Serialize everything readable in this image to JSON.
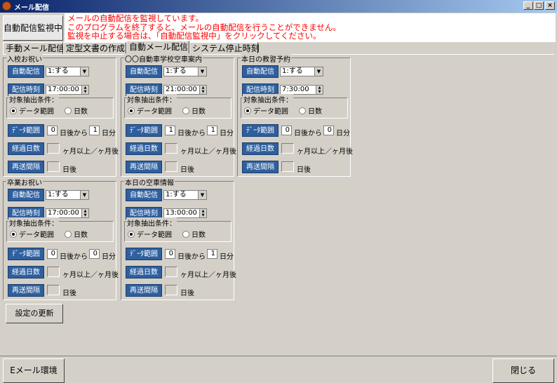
{
  "window": {
    "title": "メール配信"
  },
  "monitor_button": "自動配信監視中",
  "messages": [
    "メールの自動配信を監視しています。",
    "このプログラムを終了すると、メールの自動配信を行うことができません。",
    "監視を中止する場合は、「自動配信監視中」をクリックしてください。"
  ],
  "tabs": [
    "手動メール配信",
    "定型文書の作成",
    "自動メール配信",
    "システム停止時刻"
  ],
  "active_tab": "自動メール配信",
  "common": {
    "auto_btn": "自動配信",
    "time_btn": "配信時刻",
    "cond_label": "対象抽出条件：",
    "radio_range": "データ範囲",
    "radio_days": "日数",
    "range_btn": "ﾃﾞｰﾀ範囲",
    "range_from": "日後から",
    "range_to": "日分",
    "elapsed_btn": "経過日数",
    "elapsed_text": "ヶ月以上／ヶ月後",
    "resend_btn": "再送間隔",
    "resend_text": "日後"
  },
  "groups": [
    {
      "title": "入校お祝い",
      "auto": "1:する",
      "time": "17:00:00",
      "from": "0",
      "to": "1"
    },
    {
      "title": "〇〇自動車学校空車案内",
      "auto": "1:する",
      "time": "21:00:00",
      "from": "1",
      "to": "1"
    },
    {
      "title": "本日の教習予約",
      "auto": "1:する",
      "time": "7:30:00",
      "from": "0",
      "to": "0"
    },
    {
      "title": "卒業お祝い",
      "auto": "1:する",
      "time": "17:00:00",
      "from": "0",
      "to": "0"
    },
    {
      "title": "本日の空車情報",
      "auto": "1:する",
      "time": "13:00:00",
      "from": "0",
      "to": "1"
    }
  ],
  "update_button": "設定の更新",
  "email_button": "Eメール環境",
  "close_button": "閉じる",
  "icons": {
    "app": "mail-app-icon",
    "minimize": "minimize-icon",
    "maximize": "maximize-icon",
    "close": "close-icon",
    "dropdown": "dropdown-arrow-icon",
    "spinner": "spinner-icon"
  }
}
